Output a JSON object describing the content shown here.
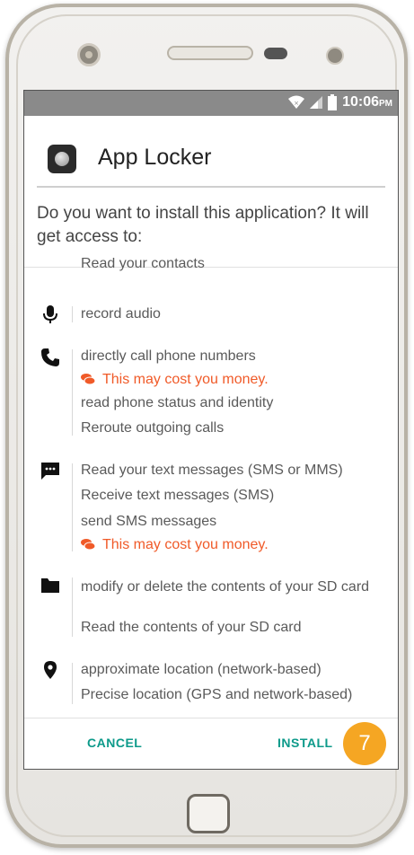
{
  "status_bar": {
    "time": "10:06",
    "ampm": "PM"
  },
  "app": {
    "name": "App Locker",
    "icon": "app-locker-icon"
  },
  "prompt": "Do you want to install this application? It will get access to:",
  "permissions": {
    "contacts": {
      "icon": "",
      "lines": [
        "Read your contacts"
      ]
    },
    "microphone": {
      "icon": "microphone-icon",
      "lines": [
        "record audio"
      ]
    },
    "phone": {
      "icon": "phone-icon",
      "lines": [
        "directly call phone numbers",
        "This may cost you money.",
        "read phone status and identity",
        "Reroute outgoing calls"
      ]
    },
    "sms": {
      "icon": "sms-icon",
      "lines": [
        "Read your text messages (SMS or MMS)",
        "Receive text messages (SMS)",
        "send SMS messages",
        "This may cost you money."
      ]
    },
    "storage": {
      "icon": "folder-icon",
      "lines": [
        "modify or delete the contents of your SD card",
        "Read the contents of your SD card"
      ]
    },
    "location": {
      "icon": "location-pin-icon",
      "lines": [
        "approximate location (network-based)",
        "Precise location (GPS and network-based)"
      ]
    }
  },
  "warning_color": "#f05a28",
  "accent_color": "#0d9a8a",
  "buttons": {
    "cancel": "CANCEL",
    "install": "INSTALL"
  },
  "step_badge": "7"
}
